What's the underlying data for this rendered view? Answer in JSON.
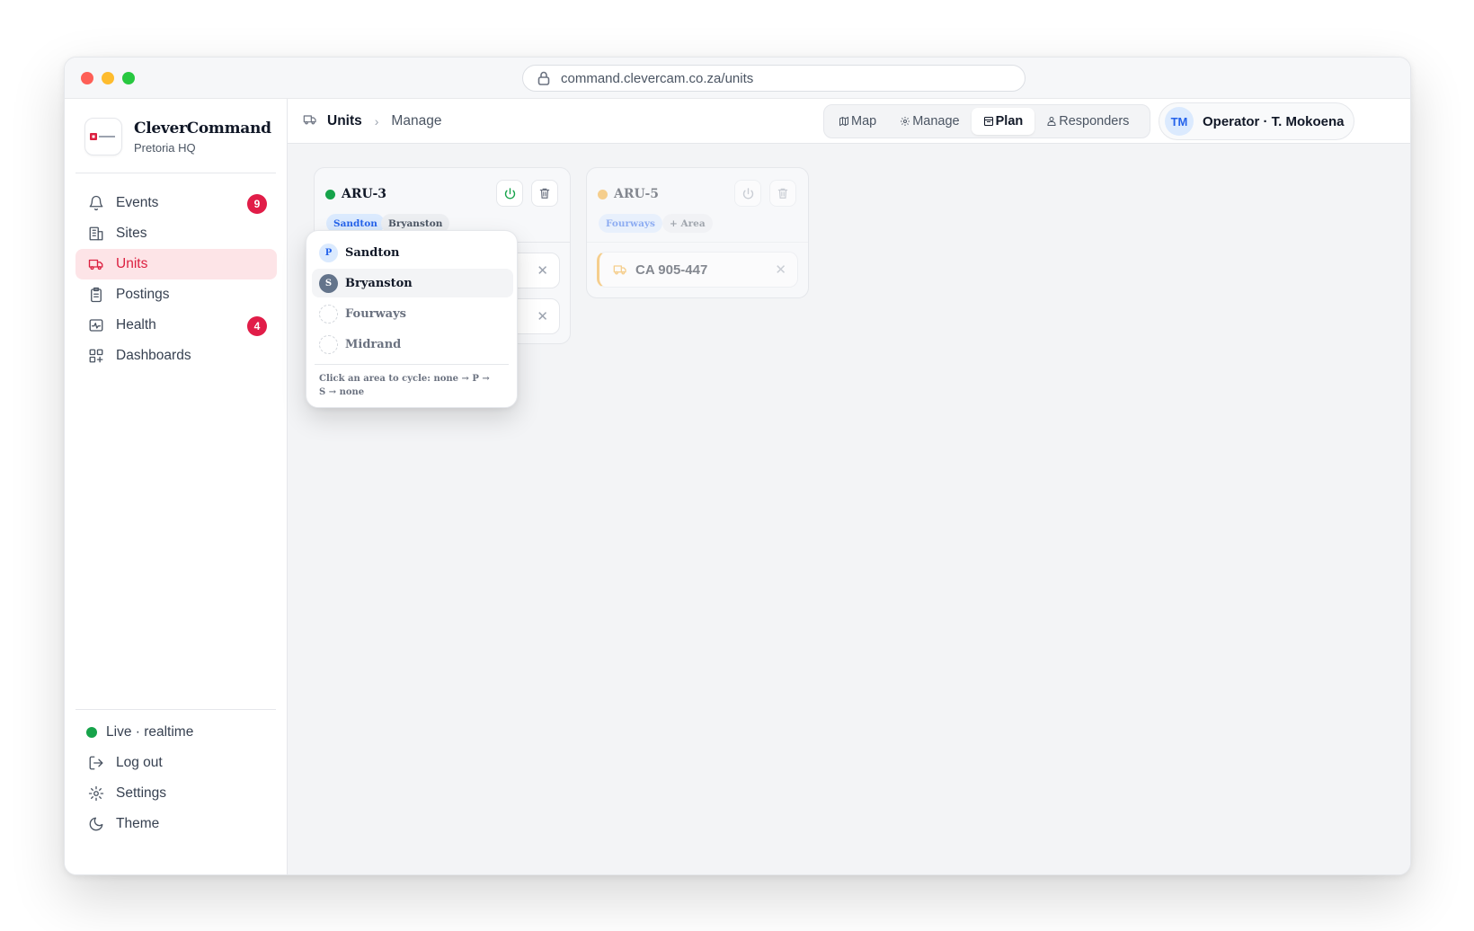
{
  "browser": {
    "url": "command.clevercam.co.za/units"
  },
  "brand": {
    "name": "CleverCommand",
    "location": "Pretoria HQ"
  },
  "sidebar": {
    "items": [
      {
        "label": "Events",
        "icon": "bell-icon",
        "badge": "9"
      },
      {
        "label": "Sites",
        "icon": "building-icon"
      },
      {
        "label": "Units",
        "icon": "truck-icon",
        "active": true
      },
      {
        "label": "Postings",
        "icon": "clipboard-icon"
      },
      {
        "label": "Health",
        "icon": "pulse-icon",
        "badge": "4"
      },
      {
        "label": "Dashboards",
        "icon": "dashboard-icon"
      }
    ],
    "footer": {
      "status": "Live · realtime",
      "logout": "Log out",
      "settings": "Settings",
      "theme": "Theme"
    }
  },
  "header": {
    "breadcrumb": {
      "section": "Units",
      "page": "Manage"
    },
    "views": [
      {
        "label": "Map",
        "icon": "map-icon"
      },
      {
        "label": "Manage",
        "icon": "gear-icon"
      },
      {
        "label": "Plan",
        "icon": "calendar-icon",
        "active": true
      },
      {
        "label": "Responders",
        "icon": "person-icon"
      }
    ],
    "operator": {
      "initials": "TM",
      "label": "Operator · T. Mokoena"
    }
  },
  "units": [
    {
      "name": "ARU-3",
      "status_color": "#16a34a",
      "areas": [
        {
          "label": "Sandton",
          "role": "primary"
        },
        {
          "label": "Bryanston",
          "role": "secondary"
        }
      ]
    },
    {
      "name": "ARU-5",
      "status_color": "#f5a623",
      "areas": [
        {
          "label": "Fourways",
          "role": "primary"
        }
      ],
      "add_area_label": "+ Area",
      "vehicles": [
        {
          "plate": "CA 905-447"
        }
      ]
    }
  ],
  "area_popover": {
    "options": [
      {
        "label": "Sandton",
        "mark": "P"
      },
      {
        "label": "Bryanston",
        "mark": "S"
      },
      {
        "label": "Fourways",
        "mark": ""
      },
      {
        "label": "Midrand",
        "mark": ""
      }
    ],
    "hint": "Click an area to cycle: none → P → S → none"
  },
  "colors": {
    "accent": "#dc2040",
    "badge": "#e11d48",
    "primary_chip": "#2563eb",
    "live": "#16a34a",
    "vehicle_accent": "#f5a623"
  }
}
